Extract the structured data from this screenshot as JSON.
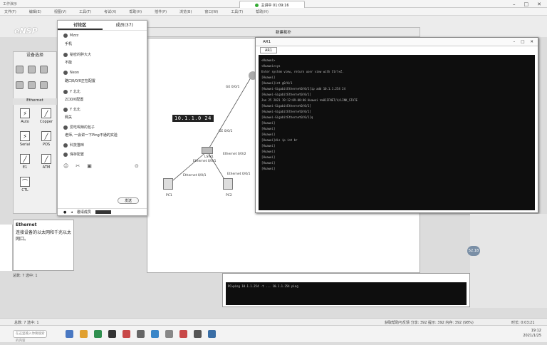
{
  "topbar": {
    "left_text": "工作演示",
    "meeting": "主讲中 01:09:16",
    "menus": [
      "文件(F)",
      "编辑(E)",
      "视图(V)",
      "工具(T)",
      "考试(X)",
      "帮助(H)",
      "插件(P)",
      "浏览(B)",
      "窗口(W)",
      "工具(T)",
      "帮助(H)"
    ]
  },
  "ensp": {
    "logo": "eNSP",
    "device_panel_title": "设备选择",
    "category": "Ethernet",
    "cables": [
      {
        "label": "Auto",
        "glyph": "⚡"
      },
      {
        "label": "Copper",
        "glyph": "╱"
      },
      {
        "label": "Serial",
        "glyph": "⚡"
      },
      {
        "label": "POS",
        "glyph": "╱"
      },
      {
        "label": "E1",
        "glyph": "╱"
      },
      {
        "label": "ATM",
        "glyph": "╱"
      },
      {
        "label": "CTL",
        "glyph": "⌒"
      }
    ],
    "desc_title": "Ethernet",
    "desc_text": "连接设备的以太网和千兆以太网口。",
    "status": "总数: 7 选中: 1",
    "canvas_title": "新建拓扑"
  },
  "chat": {
    "tabs": [
      "讨论区",
      "成员(37)"
    ],
    "messages": [
      {
        "user": "Mzzz",
        "text": "手机"
      },
      {
        "user": "秘密的胖大大",
        "text": "不能"
      },
      {
        "user": "Neon",
        "text": "路口0/0/0正在配置"
      },
      {
        "user": "Y 北北",
        "text": "2口0/0配置"
      },
      {
        "user": "Y 北北",
        "text": "网关"
      },
      {
        "user": "爱吃喝辣的包子",
        "text": "老师, 一会讲一下Ping不通的实验"
      },
      {
        "user": "科技猫咪",
        "text": ""
      },
      {
        "user": "聊天助手",
        "text": "保存配置"
      }
    ],
    "send": "发送",
    "bottom_text": "邀请成员"
  },
  "topology": {
    "ip": "10.1.1.0 24",
    "links": [
      "GE 0/0/1",
      "GE 0/0/1",
      "Ethernet 0/0/2",
      "Ethernet 0/0/1",
      "Ethernet 0/0/1",
      "Ethernet 0/0/1"
    ],
    "devices": [
      "LSW1",
      "PC1",
      "PC2"
    ]
  },
  "terminal": {
    "title": "AR1",
    "tab": "AR1",
    "lines": [
      "<Huawei>",
      "<Huawei>sys",
      "Enter system view, return user view with Ctrl+Z.",
      "[Huawei]",
      "[Huawei]int g0/0/1",
      "[Huawei-GigabitEthernet0/0/1]ip add 10.1.1.254 24",
      "[Huawei-GigabitEthernet0/0/1]",
      "Jan 25 2021 19:12:09-08:00 Huawei %%01IFNET/4/LINK_STATE",
      "[Huawei-GigabitEthernet0/0/1]",
      "[Huawei-GigabitEthernet0/0/1]",
      "[Huawei-GigabitEthernet0/0/1]q",
      "[Huawei]",
      "[Huawei]",
      "[Huawei]",
      "[Huawei]dis ip int br",
      "[Huawei]",
      "[Huawei]",
      "[Huawei]",
      "[Huawei]",
      "[Huawei]"
    ],
    "lower_line": "PC>ping 10.1.1.254 -t  ...  10.1.1.254 ping"
  },
  "bubble": "52.18",
  "zoombar": {
    "left": "总数: 7 选中: 1",
    "right": "获取帮助与反馈 分享: 392  提示: 392  内存: 392 (98%)",
    "extra": "时长: 0:03:21"
  },
  "taskbar": {
    "search": "在这里输入你要搜索的内容",
    "time": "19:12",
    "date": "2021/1/25"
  }
}
